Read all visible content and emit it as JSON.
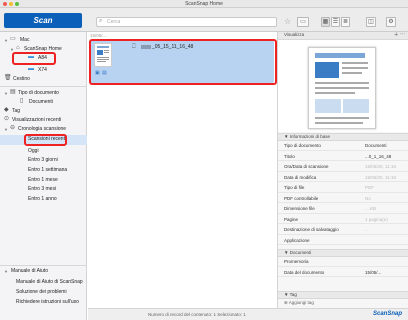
{
  "window": {
    "title": "ScanSnap Home"
  },
  "toolbar": {
    "scan_label": "Scan",
    "search_placeholder": "Cerca"
  },
  "sidebar": {
    "top": [
      {
        "label": "Mac",
        "indent": 0,
        "icon": "computer-icon",
        "expander": "▼"
      },
      {
        "label": "ScanSnap Home",
        "indent": 1,
        "icon": "home-icon",
        "expander": "▼"
      },
      {
        "label": "A84",
        "indent": 2,
        "icon": "folder-icon",
        "expander": ""
      },
      {
        "label": "X74",
        "indent": 2,
        "icon": "folder-icon",
        "expander": ""
      },
      {
        "label": "Cestino",
        "indent": 0,
        "icon": "trash-icon",
        "expander": ""
      }
    ],
    "middle": [
      {
        "label": "Tipo di documento",
        "indent": 0,
        "icon": "document-type-icon",
        "expander": "▼"
      },
      {
        "label": "Documenti",
        "indent": 1,
        "icon": "document-icon",
        "expander": ""
      },
      {
        "label": "Tag",
        "indent": 0,
        "icon": "tag-icon",
        "expander": ""
      },
      {
        "label": "Visualizzazioni recenti",
        "indent": 0,
        "icon": "recent-icon",
        "expander": ""
      },
      {
        "label": "Cronologia scansione",
        "indent": 0,
        "icon": "history-icon",
        "expander": "▼"
      },
      {
        "label": "Scansioni recenti",
        "indent": 1,
        "icon": "",
        "expander": ""
      },
      {
        "label": "Oggi",
        "indent": 1,
        "icon": "",
        "expander": ""
      },
      {
        "label": "Entro 3 giorni",
        "indent": 1,
        "icon": "",
        "expander": ""
      },
      {
        "label": "Entro 1 settimana",
        "indent": 1,
        "icon": "",
        "expander": ""
      },
      {
        "label": "Entro 1 mese",
        "indent": 1,
        "icon": "",
        "expander": ""
      },
      {
        "label": "Entro 3 mesi",
        "indent": 1,
        "icon": "",
        "expander": ""
      },
      {
        "label": "Entro 1 anno",
        "indent": 1,
        "icon": "",
        "expander": ""
      }
    ],
    "help": {
      "header": "Manuale di Aiuto",
      "items": [
        "Manuale di Aiuto di ScanSnap",
        "Soluzione dei problemi",
        "Richiedere istruzioni sull'uso"
      ]
    }
  },
  "content": {
    "date_header": "15/05/...",
    "document_name": "_05_15_11_16_48"
  },
  "status": {
    "text": "Numero di record del contenuto: 1 Selezionato: 1"
  },
  "right_panel": {
    "preview_label": "Visualizza",
    "info_header": "Informazioni di base",
    "info_rows": [
      {
        "key": "Tipo di documento",
        "value": "Documenti",
        "dark": true
      },
      {
        "key": "Titolo",
        "value": "...0_1_16_48",
        "dark": true
      },
      {
        "key": "Ora/Data di scansione",
        "value": "15/05/20, 11:16",
        "dark": false
      },
      {
        "key": "Data di modifica",
        "value": "15/05/20, 11:16",
        "dark": false
      },
      {
        "key": "Tipo di file",
        "value": "PDF",
        "dark": false
      },
      {
        "key": "PDF controllabile",
        "value": "No",
        "dark": false
      },
      {
        "key": "Dimensione file",
        "value": "... KB",
        "dark": false
      },
      {
        "key": "Pagine",
        "value": "1 pagina(e)",
        "dark": false
      },
      {
        "key": "Destinazione di salvataggio",
        "value": "...",
        "dark": false
      },
      {
        "key": "Applicazione",
        "value": "",
        "dark": false
      }
    ],
    "doc_header": "Documenti",
    "doc_rows": [
      {
        "key": "Promemoria",
        "value": "",
        "dark": false
      },
      {
        "key": "Data del documento",
        "value": "15/05/...",
        "dark": true
      }
    ],
    "tag_header": "Tag",
    "add_tag_label": "Aggiungi tag",
    "brand": "ScanSnap"
  }
}
